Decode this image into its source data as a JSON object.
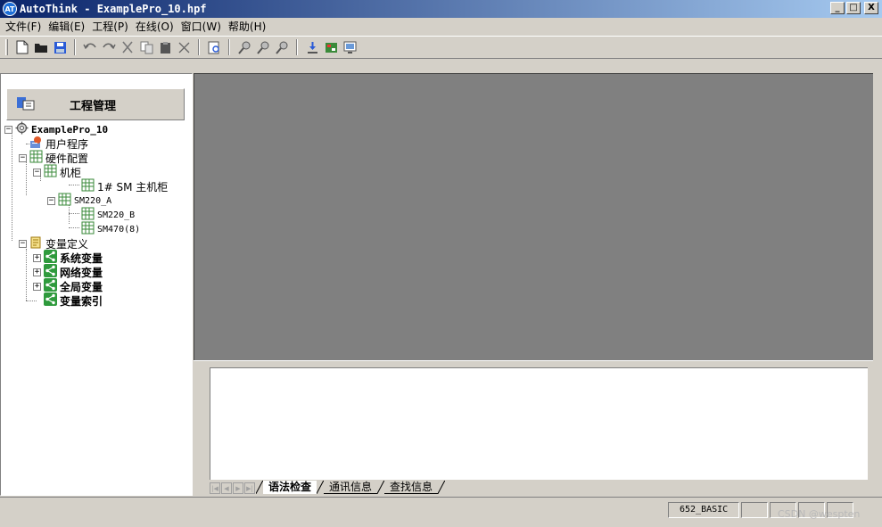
{
  "window": {
    "app_icon_text": "AT",
    "title": "AutoThink - ExamplePro_10.hpf",
    "minimize": "_",
    "maximize": "□",
    "close": "X"
  },
  "menu": [
    "文件(F)",
    "编辑(E)",
    "工程(P)",
    "在线(O)",
    "窗口(W)",
    "帮助(H)"
  ],
  "toolbar_icons": [
    "new-icon",
    "open-icon",
    "save-icon",
    "undo-icon",
    "redo-icon",
    "cut-icon",
    "copy-icon",
    "paste-icon",
    "delete-icon",
    "preview-icon",
    "find-icon",
    "find-next-icon",
    "replace-icon",
    "download-icon",
    "compile-icon",
    "monitor-icon"
  ],
  "project_panel": {
    "title": "工程管理"
  },
  "tree": {
    "project": "ExamplePro_10",
    "user_program": "用户程序",
    "hardware_config": "硬件配置",
    "cabinet": "机柜",
    "main_cabinet": "1# SM 主机柜",
    "sm220a": "SM220_A",
    "sm220b": "SM220_B",
    "sm470": "SM470(8)",
    "var_def": "变量定义",
    "sys_vars": "系统变量",
    "net_vars": "网络变量",
    "global_vars": "全局变量",
    "var_index": "变量索引"
  },
  "output": {
    "tabs": [
      "语法检查",
      "通讯信息",
      "查找信息"
    ],
    "active_tab": 0
  },
  "status": {
    "model": "652_BASIC",
    "watermark": "CSDN @wespten"
  },
  "colors": {
    "title_start": "#0a246a",
    "title_end": "#a6caf0",
    "workspace": "#808080",
    "face": "#d4d0c8"
  }
}
